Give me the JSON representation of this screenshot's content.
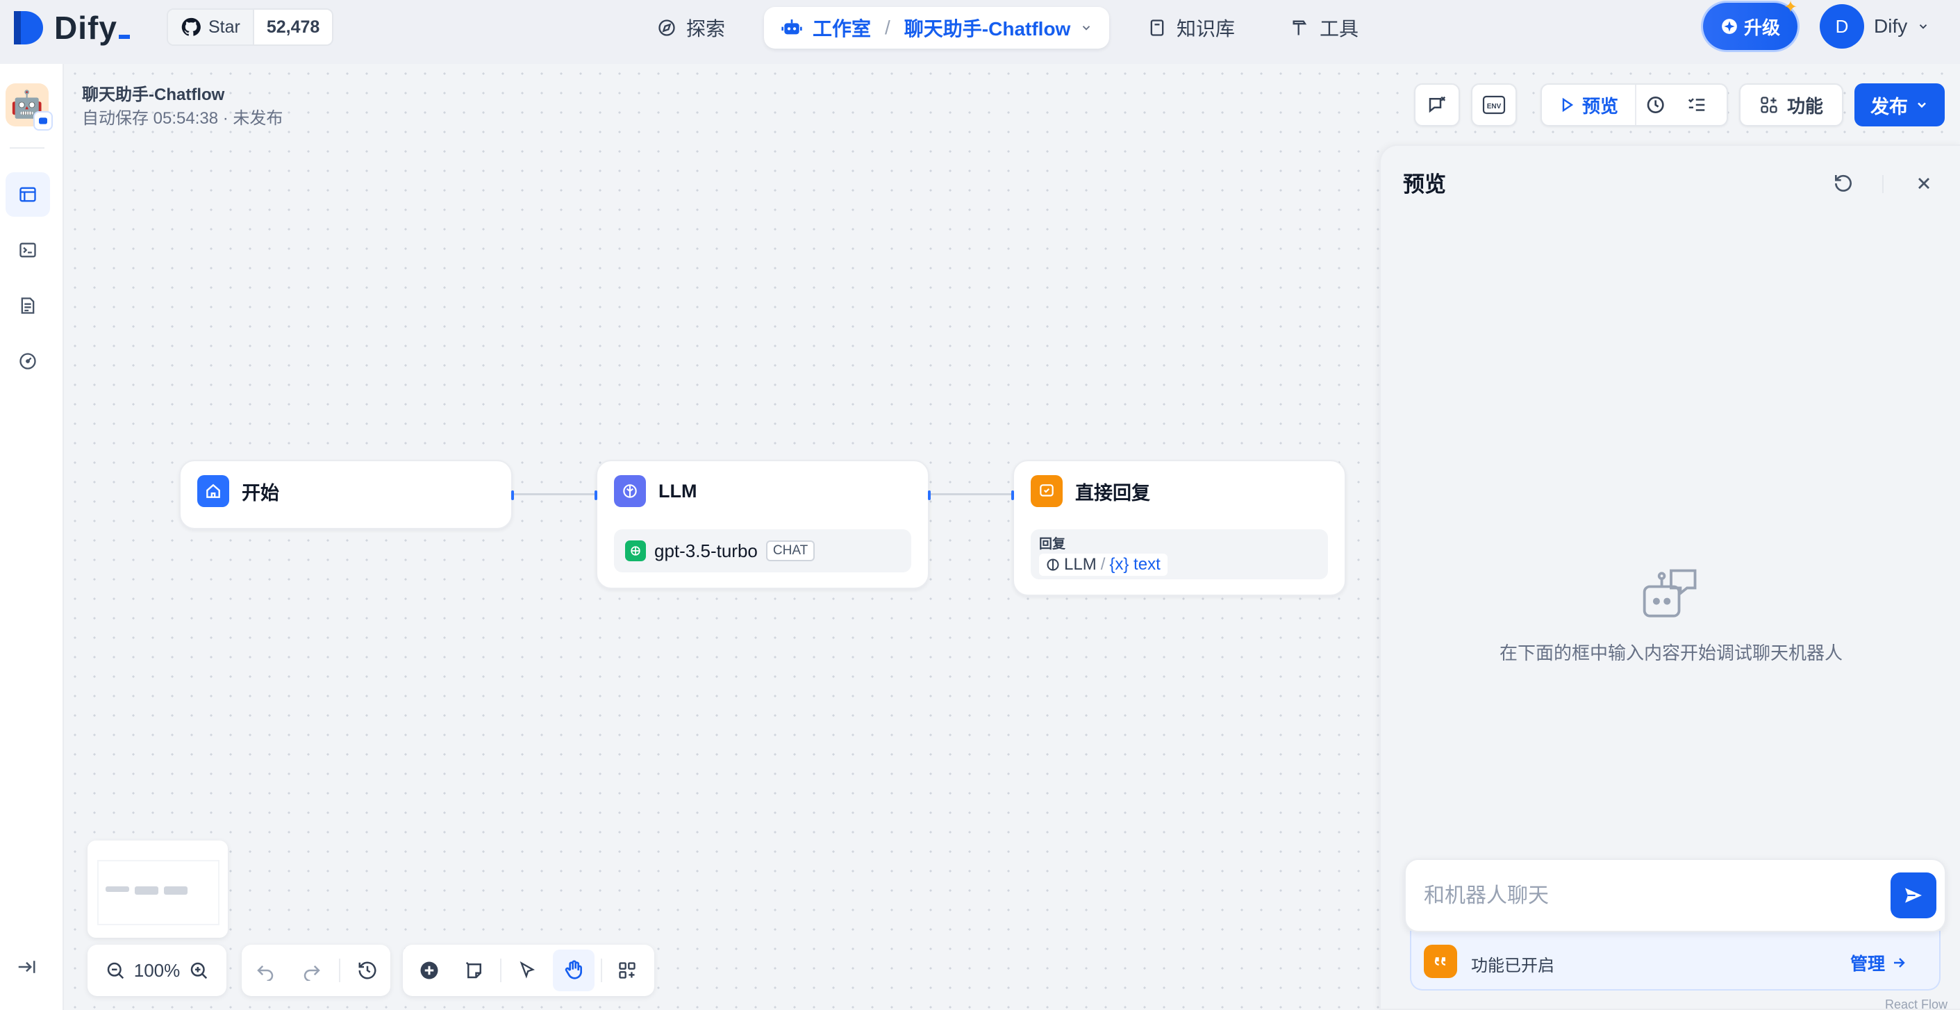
{
  "brand": {
    "name": "Dify"
  },
  "github": {
    "star_label": "Star",
    "count": "52,478"
  },
  "nav": {
    "explore": "探索",
    "studio": "工作室",
    "separator": "/",
    "app_name": "聊天助手-Chatflow",
    "knowledge": "知识库",
    "tools": "工具"
  },
  "upgrade": {
    "label": "升级"
  },
  "user": {
    "initial": "D",
    "name": "Dify"
  },
  "app": {
    "title": "聊天助手-Chatflow",
    "status": "自动保存 05:54:38 · 未发布"
  },
  "toolbar": {
    "preview": "预览",
    "features": "功能",
    "publish": "发布"
  },
  "nodes": {
    "start": {
      "title": "开始"
    },
    "llm": {
      "title": "LLM",
      "model": "gpt-3.5-turbo",
      "mode": "CHAT"
    },
    "reply": {
      "title": "直接回复",
      "field_label": "回复",
      "var_node": "LLM",
      "var_sep": "/",
      "var_name": "{x} text"
    }
  },
  "controls": {
    "zoom": "100%"
  },
  "preview": {
    "title": "预览",
    "hint": "在下面的框中输入内容开始调试聊天机器人",
    "input_placeholder": "和机器人聊天",
    "features_enabled": "功能已开启",
    "manage": "管理"
  },
  "footer": {
    "watermark": "React Flow"
  },
  "colors": {
    "primary": "#155eef",
    "llm": "#6172f3",
    "reply": "#f79009",
    "openai": "#12b76a"
  }
}
